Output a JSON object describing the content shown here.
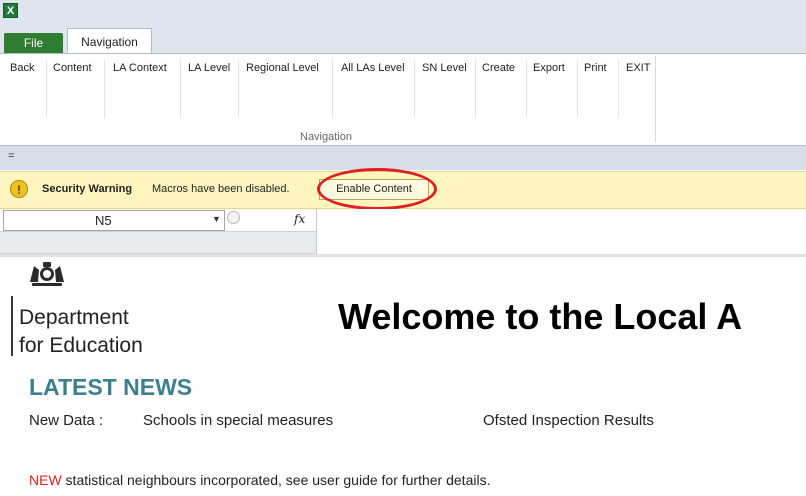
{
  "app": {
    "icon": "excel-icon",
    "icon_glyph": "X"
  },
  "tabs": {
    "file": "File",
    "navigation": "Navigation"
  },
  "ribbon": {
    "buttons": [
      "Back",
      "Content",
      "LA Context",
      "LA Level",
      "Regional Level",
      "All LAs Level",
      "SN Level",
      "Create",
      "Export",
      "Print",
      "EXIT"
    ],
    "group_label": "Navigation"
  },
  "qat": {
    "arrow": "="
  },
  "security": {
    "icon": "warning-icon",
    "icon_glyph": "!",
    "title": "Security Warning",
    "message": "Macros have been disabled.",
    "button": "Enable Content",
    "highlight_color": "#e02020"
  },
  "formula_bar": {
    "name_box": "N5",
    "fx": "fx",
    "value": ""
  },
  "sheet": {
    "department_line1": "Department",
    "department_line2": "for Education",
    "welcome": "Welcome to the Local A",
    "latest_news": "LATEST NEWS",
    "new_data_label": "New Data :",
    "new_data_items": [
      "Schools in special measures",
      "Ofsted Inspection Results"
    ],
    "new_tag": "NEW",
    "new_text": " statistical neighbours incorporated, see user guide for further details."
  },
  "colors": {
    "file_tab": "#2e7d32",
    "security_bar": "#fff6bf",
    "news_heading": "#3d7f8f",
    "new_tag": "#e0211d"
  }
}
